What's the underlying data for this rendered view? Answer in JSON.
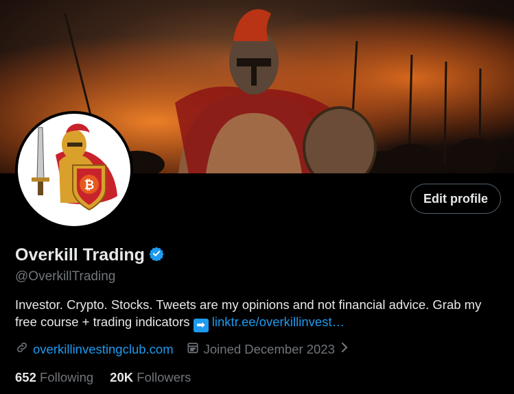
{
  "profile": {
    "display_name": "Overkill Trading",
    "handle": "@OverkillTrading",
    "verified": true,
    "edit_label": "Edit profile",
    "bio_text": "Investor. Crypto. Stocks. Tweets are my opinions and not financial advice. Grab my free course + trading indicators",
    "bio_emoji": "➡",
    "bio_link": "linktr.ee/overkillinvest…",
    "website": "overkillinvestingclub.com",
    "joined": "Joined December 2023",
    "following_count": "652",
    "following_label": "Following",
    "followers_count": "20K",
    "followers_label": "Followers"
  },
  "colors": {
    "accent": "#1d9bf0",
    "muted": "#71767b",
    "text": "#e7e9ea",
    "background": "#000000"
  },
  "icons": {
    "verified": "verified-badge-icon",
    "link": "link-icon",
    "calendar": "calendar-icon",
    "chevron": "chevron-right-icon"
  }
}
